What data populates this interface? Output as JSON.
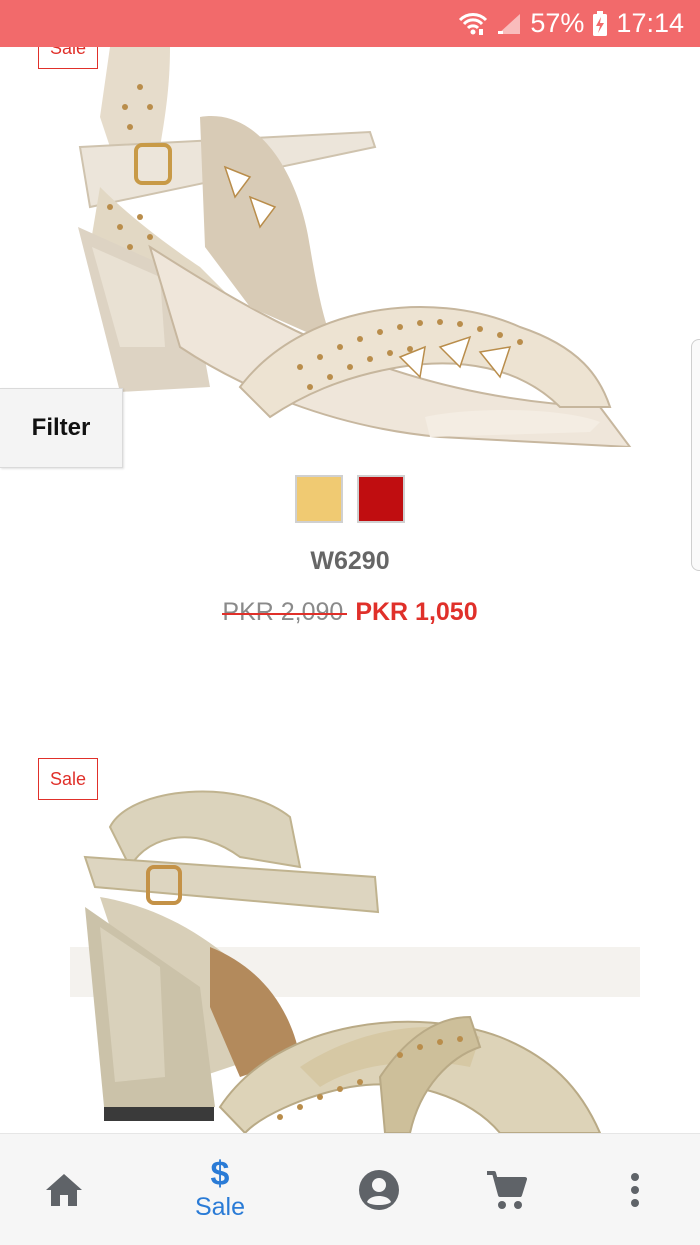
{
  "status_bar": {
    "battery": "57%",
    "time": "17:14"
  },
  "products": [
    {
      "badge": "Sale",
      "swatch_colors": [
        "#f0ca72",
        "#c00d10"
      ],
      "name": "W6290",
      "old_price": "PKR 2,090",
      "new_price": "PKR 1,050"
    },
    {
      "badge": "Sale"
    }
  ],
  "filter": {
    "label": "Filter"
  },
  "bottom_nav": {
    "items": [
      {
        "icon": "home-icon"
      },
      {
        "icon": "dollar-icon",
        "label": "Sale",
        "glyph": "$"
      },
      {
        "icon": "account-icon"
      },
      {
        "icon": "cart-icon"
      },
      {
        "icon": "more-vert-icon"
      }
    ]
  },
  "colors": {
    "status_bar": "#f26a6b",
    "accent": "#2a7bd6",
    "sale_red": "#e0302a"
  }
}
